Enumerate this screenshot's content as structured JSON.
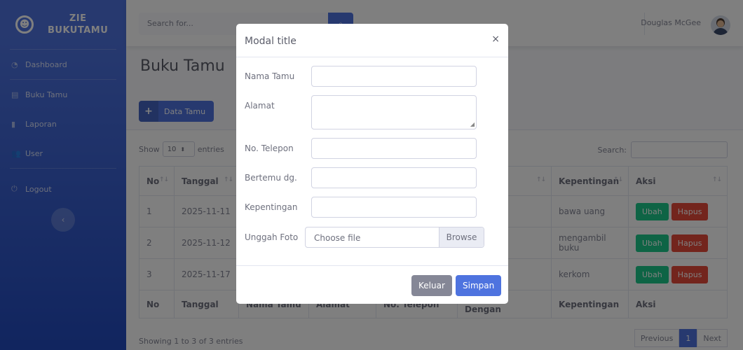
{
  "brand": {
    "line1": "ZIE",
    "line2": "BUKUTAMU",
    "logo_icon": "laugh-wink-icon"
  },
  "sidebar": {
    "items": [
      {
        "label": "Dashboard",
        "icon": "tachometer-icon"
      },
      {
        "label": "Buku Tamu",
        "icon": "book-icon"
      },
      {
        "label": "Laporan",
        "icon": "file-icon"
      },
      {
        "label": "User",
        "icon": "users-icon"
      },
      {
        "label": "Logout",
        "icon": "power-off-icon"
      }
    ]
  },
  "topbar": {
    "search_placeholder": "Search for...",
    "user_name": "Douglas McGee"
  },
  "page": {
    "title": "Buku Tamu",
    "add_button": "Data Tamu"
  },
  "table": {
    "length_prefix": "Show",
    "length_value": "10",
    "length_suffix": "entries",
    "search_label": "Search:",
    "headers": [
      "No",
      "Tanggal",
      "Nama Tamu",
      "Alamat",
      "No. Telepon",
      "Bertemu Dengan",
      "Kepentingan",
      "Aksi"
    ],
    "rows": [
      {
        "no": "1",
        "tanggal": "2025-11-11",
        "kepentingan": "bawa uang"
      },
      {
        "no": "2",
        "tanggal": "2025-11-12",
        "kepentingan": "mengambil buku"
      },
      {
        "no": "3",
        "tanggal": "2025-11-17",
        "kepentingan": "kerkom"
      }
    ],
    "action_edit": "Ubah",
    "action_delete": "Hapus",
    "info": "Showing 1 to 3 of 3 entries",
    "pagination": {
      "previous": "Previous",
      "current": "1",
      "next": "Next"
    }
  },
  "modal": {
    "title": "Modal title",
    "close": "×",
    "fields": {
      "nama": "Nama Tamu",
      "alamat": "Alamat",
      "telepon": "No. Telepon",
      "bertemu": "Bertemu dg.",
      "kepentingan": "Kepentingan",
      "foto": "Unggah Foto"
    },
    "file_placeholder": "Choose file",
    "file_button": "Browse",
    "btn_cancel": "Keluar",
    "btn_save": "Simpan"
  },
  "colors": {
    "primary": "#4e73df",
    "success": "#1cc88a",
    "danger": "#e74a3b",
    "secondary": "#858796"
  }
}
